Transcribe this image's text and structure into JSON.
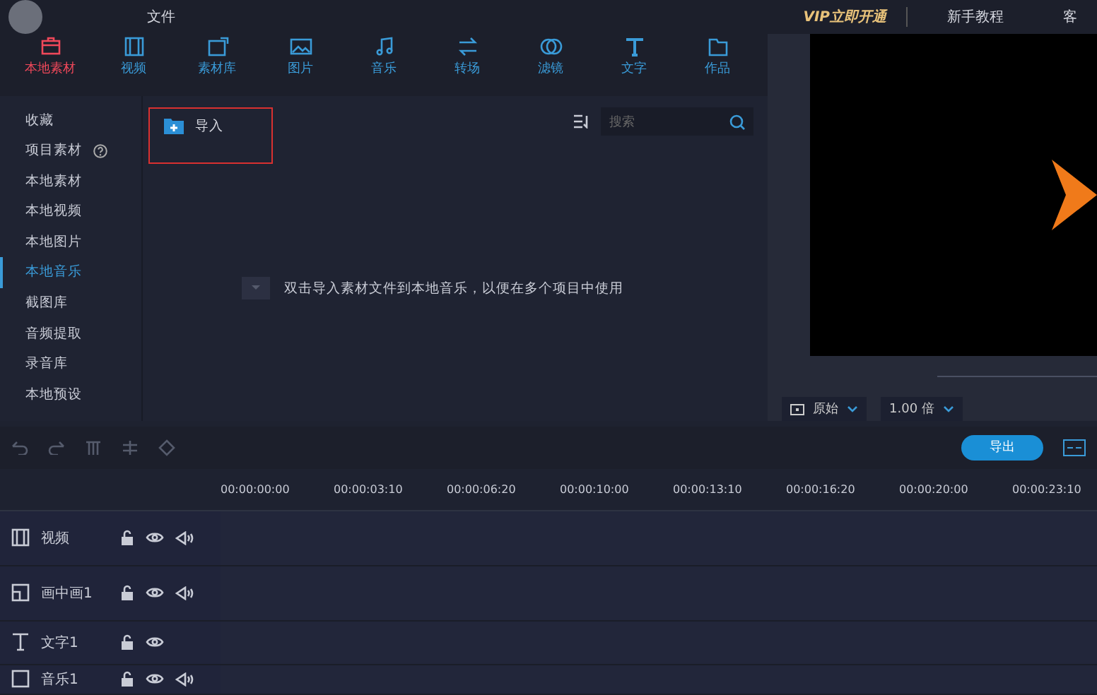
{
  "top_bar": {
    "menu": [
      "文件"
    ],
    "links": [
      {
        "label": "VIP立即开通",
        "kind": "vip"
      },
      {
        "label": "新手教程",
        "kind": "plain"
      },
      {
        "label": "客",
        "kind": "plain"
      }
    ]
  },
  "tabs": [
    {
      "label": "本地素材",
      "kind": "box",
      "selected": true
    },
    {
      "label": "视频",
      "kind": "film",
      "selected": false
    },
    {
      "label": "素材库",
      "kind": "library",
      "selected": false
    },
    {
      "label": "图片",
      "kind": "image",
      "selected": false
    },
    {
      "label": "音乐",
      "kind": "music",
      "selected": false
    },
    {
      "label": "转场",
      "kind": "swap",
      "selected": false
    },
    {
      "label": "滤镜",
      "kind": "rings",
      "selected": false
    },
    {
      "label": "文字",
      "kind": "text",
      "selected": false
    },
    {
      "label": "作品",
      "kind": "folder",
      "selected": false
    }
  ],
  "sidebar": {
    "items": [
      {
        "label": "收藏",
        "selected": false,
        "help": false
      },
      {
        "label": "项目素材",
        "selected": false,
        "help": true
      },
      {
        "label": "本地素材",
        "selected": false,
        "help": false
      },
      {
        "label": "本地视频",
        "selected": false,
        "help": false
      },
      {
        "label": "本地图片",
        "selected": false,
        "help": false
      },
      {
        "label": "本地音乐",
        "selected": true,
        "help": false
      },
      {
        "label": "截图库",
        "selected": false,
        "help": false
      },
      {
        "label": "音频提取",
        "selected": false,
        "help": false
      },
      {
        "label": "录音库",
        "selected": false,
        "help": false
      },
      {
        "label": "本地预设",
        "selected": false,
        "help": false
      }
    ]
  },
  "content": {
    "import_button": "导入",
    "search": {
      "placeholder": "搜索"
    },
    "empty_message": "双击导入素材文件到本地音乐，以便在多个项目中使用"
  },
  "preview": {
    "ratio": "原始",
    "speed": "1.00 倍"
  },
  "toolbar": {
    "export_button": "导出"
  },
  "timeline": {
    "ticks": [
      "00:00:00:00",
      "00:00:03:10",
      "00:00:06:20",
      "00:00:10:00",
      "00:00:13:10",
      "00:00:16:20",
      "00:00:20:00",
      "00:00:23:10"
    ],
    "tracks": [
      {
        "name": "视频",
        "kind": "video",
        "audio": true
      },
      {
        "name": "画中画1",
        "kind": "pip",
        "audio": true
      },
      {
        "name": "文字1",
        "kind": "text",
        "audio": false
      },
      {
        "name": "音乐1",
        "kind": "music",
        "audio": true
      }
    ]
  }
}
